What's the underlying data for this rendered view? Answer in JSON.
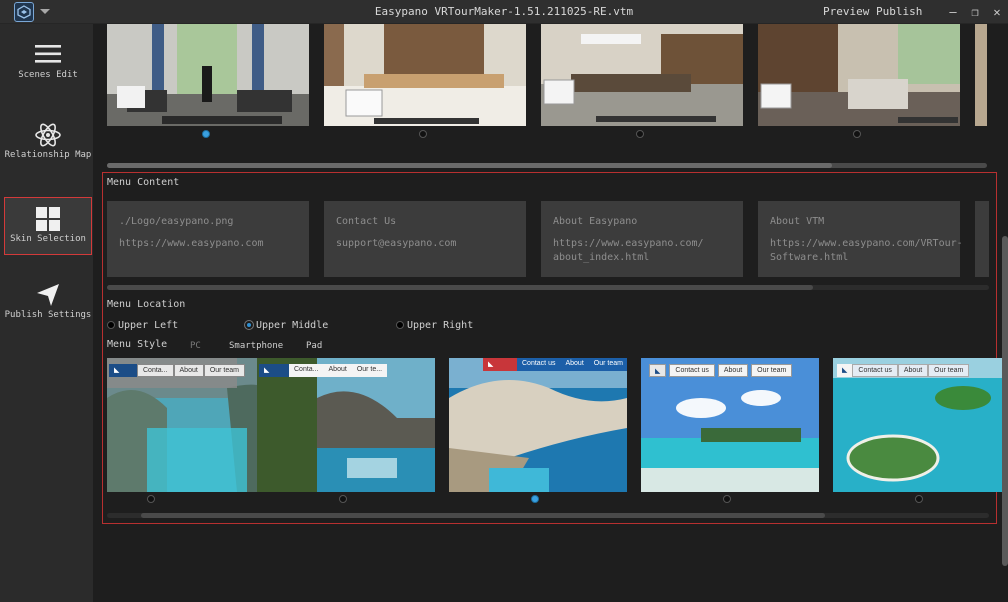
{
  "window": {
    "title": "Easypano VRTourMaker-1.51.211025-RE.vtm",
    "preview_label": "Preview",
    "publish_label": "Publish",
    "minimize_glyph": "—",
    "maximize_glyph": "❐",
    "close_glyph": "✕"
  },
  "sidebar": {
    "items": [
      {
        "label": "Scenes Edit",
        "icon": "menu-lines-icon"
      },
      {
        "label": "Relationship Map",
        "icon": "atom-icon"
      },
      {
        "label": "Skin Selection",
        "icon": "grid-icon",
        "active": true
      },
      {
        "label": "Publish Settings",
        "icon": "send-arrow-icon"
      }
    ]
  },
  "scenes": {
    "active_index": 0,
    "count": 4
  },
  "menu_content": {
    "section_label": "Menu Content",
    "cards": [
      {
        "line1": "./Logo/easypano.png",
        "line2": "https://www.easypano.com"
      },
      {
        "line1": "Contact Us",
        "line2": "support@easypano.com"
      },
      {
        "line1": "About Easypano",
        "line2": "https://www.easypano.com/",
        "line3": "about_index.html"
      },
      {
        "line1": "About VTM",
        "line2": "https://www.easypano.com/VRTour-",
        "line3": "Software.html"
      }
    ]
  },
  "menu_location": {
    "section_label": "Menu Location",
    "options": [
      {
        "label": "Upper Left",
        "checked": false
      },
      {
        "label": "Upper Middle",
        "checked": true
      },
      {
        "label": "Upper Right",
        "checked": false
      }
    ]
  },
  "menu_style": {
    "section_label": "Menu Style",
    "tabs": [
      {
        "label": "PC",
        "active": true
      },
      {
        "label": "Smartphone",
        "active": false
      },
      {
        "label": "Pad",
        "active": false
      }
    ]
  },
  "skins": {
    "active_index": 2,
    "items": [
      {
        "menu": [
          "Conta...",
          "About",
          "Our team"
        ]
      },
      {
        "menu": [
          "Conta...",
          "About",
          "Our te..."
        ]
      },
      {
        "menu": [
          "Contact us",
          "About",
          "Our team"
        ]
      },
      {
        "menu": [
          "Contact us",
          "About",
          "Our team"
        ]
      },
      {
        "menu": [
          "Contact us",
          "About",
          "Our team"
        ]
      }
    ]
  },
  "colors": {
    "accent_red": "#d33a3a",
    "accent_blue": "#3aa0e0"
  }
}
